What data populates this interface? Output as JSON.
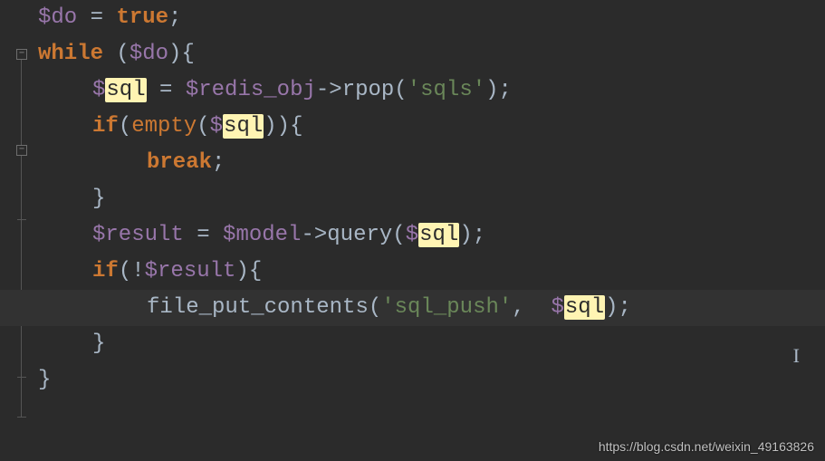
{
  "code": {
    "line1": {
      "var_do": "$do",
      "eq": " = ",
      "true": "true",
      "semi": ";"
    },
    "line2": {
      "while": "while",
      "open": " (",
      "var_do": "$do",
      "close": "){"
    },
    "line3": {
      "dollar": "$",
      "sql_hl": "sql",
      "eq": " = ",
      "redis": "$redis_obj",
      "arrow": "->",
      "rpop": "rpop",
      "paren_open": "(",
      "apos1": "'",
      "sqls": "sqls",
      "apos2": "'",
      "paren_close": ");"
    },
    "line4": {
      "if": "if",
      "open": "(",
      "empty": "empty",
      "paren_open": "(",
      "dollar": "$",
      "sql_hl": "sql",
      "paren_close": ")",
      "close": "){"
    },
    "line5": {
      "break": "break",
      "semi": ";"
    },
    "line6": {
      "brace": "}"
    },
    "line7": {
      "result": "$result",
      "eq": " = ",
      "model": "$model",
      "arrow": "->",
      "query": "query",
      "paren_open": "(",
      "dollar": "$",
      "sql_hl": "sql",
      "paren_close": ");"
    },
    "line8": {
      "if": "if",
      "open": "(!",
      "result": "$result",
      "close": "){"
    },
    "line9": {
      "fpc": "file_put_contents",
      "paren_open": "(",
      "apos1": "'",
      "sql_push": "sql_push",
      "apos2": "'",
      "comma": ",  ",
      "dollar": "$",
      "sql_hl": "sql",
      "paren_close": ");"
    },
    "line10": {
      "brace": "}"
    },
    "line11": {
      "brace": "}"
    }
  },
  "watermark": "https://blog.csdn.net/weixin_49163826",
  "highlight_token": "sql"
}
